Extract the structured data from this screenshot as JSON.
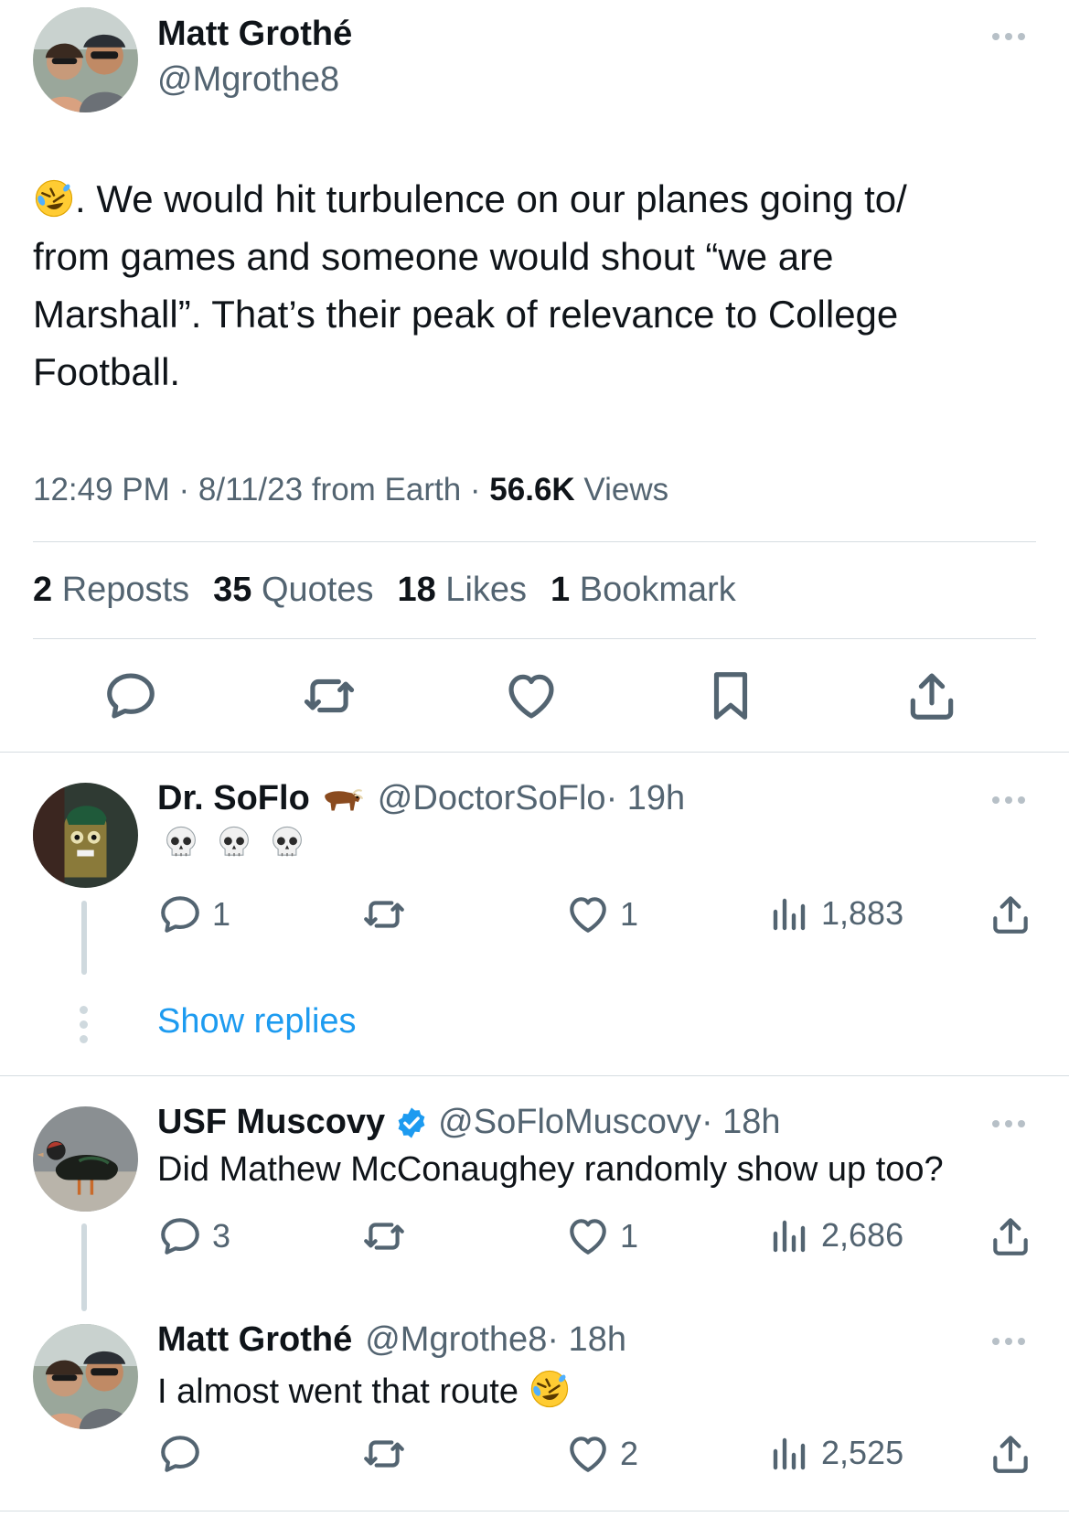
{
  "main_tweet": {
    "author_name": "Matt Grothé",
    "author_handle": "@Mgrothe8",
    "text_lines": [
      ". We would hit turbulence on our planes going to/",
      "from games and someone would shout “we are",
      "Marshall”. That’s their peak of relevance to College",
      "Football."
    ],
    "timestamp": "12:49 PM · 8/11/23 from Earth · ",
    "views_count": "56.6K",
    "views_label": " Views",
    "stats": [
      {
        "count": "2",
        "label": " Reposts"
      },
      {
        "count": "35",
        "label": " Quotes"
      },
      {
        "count": "18",
        "label": " Likes"
      },
      {
        "count": "1",
        "label": " Bookmark"
      }
    ],
    "actions": [
      "reply-icon",
      "repost-icon",
      "like-icon",
      "bookmark-icon",
      "share-icon"
    ]
  },
  "replies": [
    {
      "author_name": "Dr. SoFlo",
      "name_emoji": "ox-emoji",
      "author_handle": "@DoctorSoFlo",
      "time": " · 19h",
      "text": "",
      "text_emoji": [
        "skull-emoji",
        "skull-emoji",
        "skull-emoji"
      ],
      "reply_count": "1",
      "repost_count": "",
      "like_count": "1",
      "view_count": "1,883",
      "show_replies": "Show replies"
    },
    {
      "author_name": "USF Muscovy",
      "verified": true,
      "author_handle": "@SoFloMuscovy",
      "time": " · 18h",
      "text": "Did Mathew McConaughey randomly show up too?",
      "reply_count": "3",
      "repost_count": "",
      "like_count": "1",
      "view_count": "2,686"
    },
    {
      "author_name": "Matt Grothé",
      "author_handle": "@Mgrothe8",
      "time": " · 18h",
      "text": "I almost went that route ",
      "text_emoji": [
        "rofl-emoji"
      ],
      "reply_count": "",
      "repost_count": "",
      "like_count": "2",
      "view_count": "2,525"
    }
  ],
  "colors": {
    "text": "#0f1419",
    "secondary": "#536471",
    "link": "#1d9bf0",
    "divider": "#d6dde1",
    "verified": "#1d9bf0"
  }
}
